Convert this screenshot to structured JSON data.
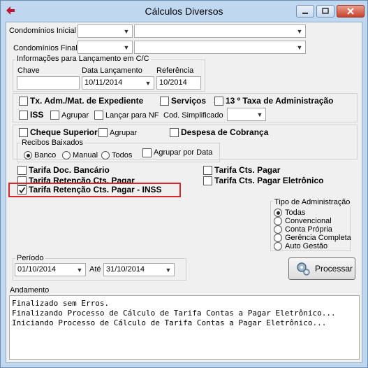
{
  "window": {
    "title": "Cálculos Diversos"
  },
  "filters": {
    "condominio_inicial_label": "Condomínios Inicial",
    "condominio_final_label": "Condomínios Final"
  },
  "lancamento": {
    "group_label": "Informações para Lançamento em C/C",
    "chave_label": "Chave",
    "chave_value": "",
    "data_label": "Data Lançamento",
    "data_value": "10/11/2014",
    "referencia_label": "Referência",
    "referencia_value": "10/2014"
  },
  "options": {
    "tx_adm": "Tx. Adm./Mat. de Expediente",
    "servicos": "Serviços",
    "taxa13": "13 º Taxa de Administração",
    "iss": "ISS",
    "agrupar1": "Agrupar",
    "lancar_nf": "Lançar para NF",
    "cod_simplificado": "Cod. Simplificado",
    "cheque_superior": "Cheque Superior",
    "agrupar2": "Agrupar",
    "despesa_cobranca": "Despesa de Cobrança"
  },
  "recibos": {
    "group_label": "Recibos Baixados",
    "banco": "Banco",
    "manual": "Manual",
    "todos": "Todos",
    "selected": "Banco",
    "agrupar_data": "Agrupar por Data"
  },
  "tarifas": {
    "doc_bancario": "Tarifa Doc. Bancário",
    "retencao": "Tarifa Retenção Cts. Pagar",
    "retencao_inss": "Tarifa Retenção Cts. Pagar - INSS",
    "cts_pagar": "Tarifa Cts. Pagar",
    "cts_pagar_eletronico": "Tarifa Cts. Pagar Eletrônico"
  },
  "tipo_admin": {
    "group_label": "Tipo de Administração",
    "items": [
      "Todas",
      "Convencional",
      "Conta Própria",
      "Gerência Completa",
      "Auto Gestão"
    ],
    "selected": "Todas"
  },
  "periodo": {
    "label": "Período",
    "inicio": "01/10/2014",
    "ate_label": "Até",
    "fim": "31/10/2014"
  },
  "processar_label": "Processar",
  "andamento": {
    "label": "Andamento",
    "lines": [
      "Finalizado sem Erros.",
      "Finalizando Processo de Cálculo de Tarifa Contas a Pagar Eletrônico...",
      "Iniciando Processo de Cálculo de Tarifa Contas a Pagar Eletrônico..."
    ]
  },
  "colors": {
    "highlight": "#d9252b",
    "title_bg": "#bfd7ef"
  }
}
